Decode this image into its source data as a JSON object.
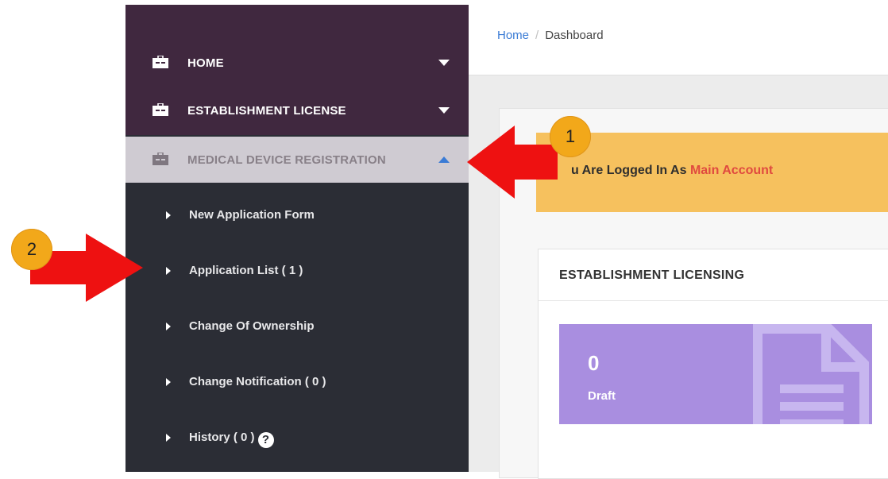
{
  "sidebar": {
    "items": [
      {
        "label": "HOME",
        "expanded": false
      },
      {
        "label": "ESTABLISHMENT LICENSE",
        "expanded": false
      },
      {
        "label": "MEDICAL DEVICE REGISTRATION",
        "expanded": true
      }
    ],
    "subitems": [
      {
        "label": "New Application Form"
      },
      {
        "label": "Application List ( 1 )"
      },
      {
        "label": "Change Of Ownership"
      },
      {
        "label": "Change Notification ( 0 )"
      },
      {
        "label": "History ( 0 )"
      }
    ],
    "help_glyph": "?"
  },
  "breadcrumb": {
    "home": "Home",
    "separator": "/",
    "current": "Dashboard"
  },
  "alert": {
    "prefix": "u Are Logged In As",
    "account": "Main Account"
  },
  "card": {
    "title": "ESTABLISHMENT LICENSING",
    "stat": {
      "value": "0",
      "label": "Draft"
    }
  },
  "annotations": {
    "badge_1": "1",
    "badge_2": "2"
  },
  "colors": {
    "sidebar_top": "#40283f",
    "sidebar_body": "#2b2d35",
    "active_item": "#cfcbd2",
    "alert_bg": "#f6c15e",
    "account_text": "#e04a3f",
    "stat_bg": "#a98ee0",
    "link": "#3a7bd5",
    "badge": "#f2a81a",
    "arrow": "#ee1111"
  }
}
